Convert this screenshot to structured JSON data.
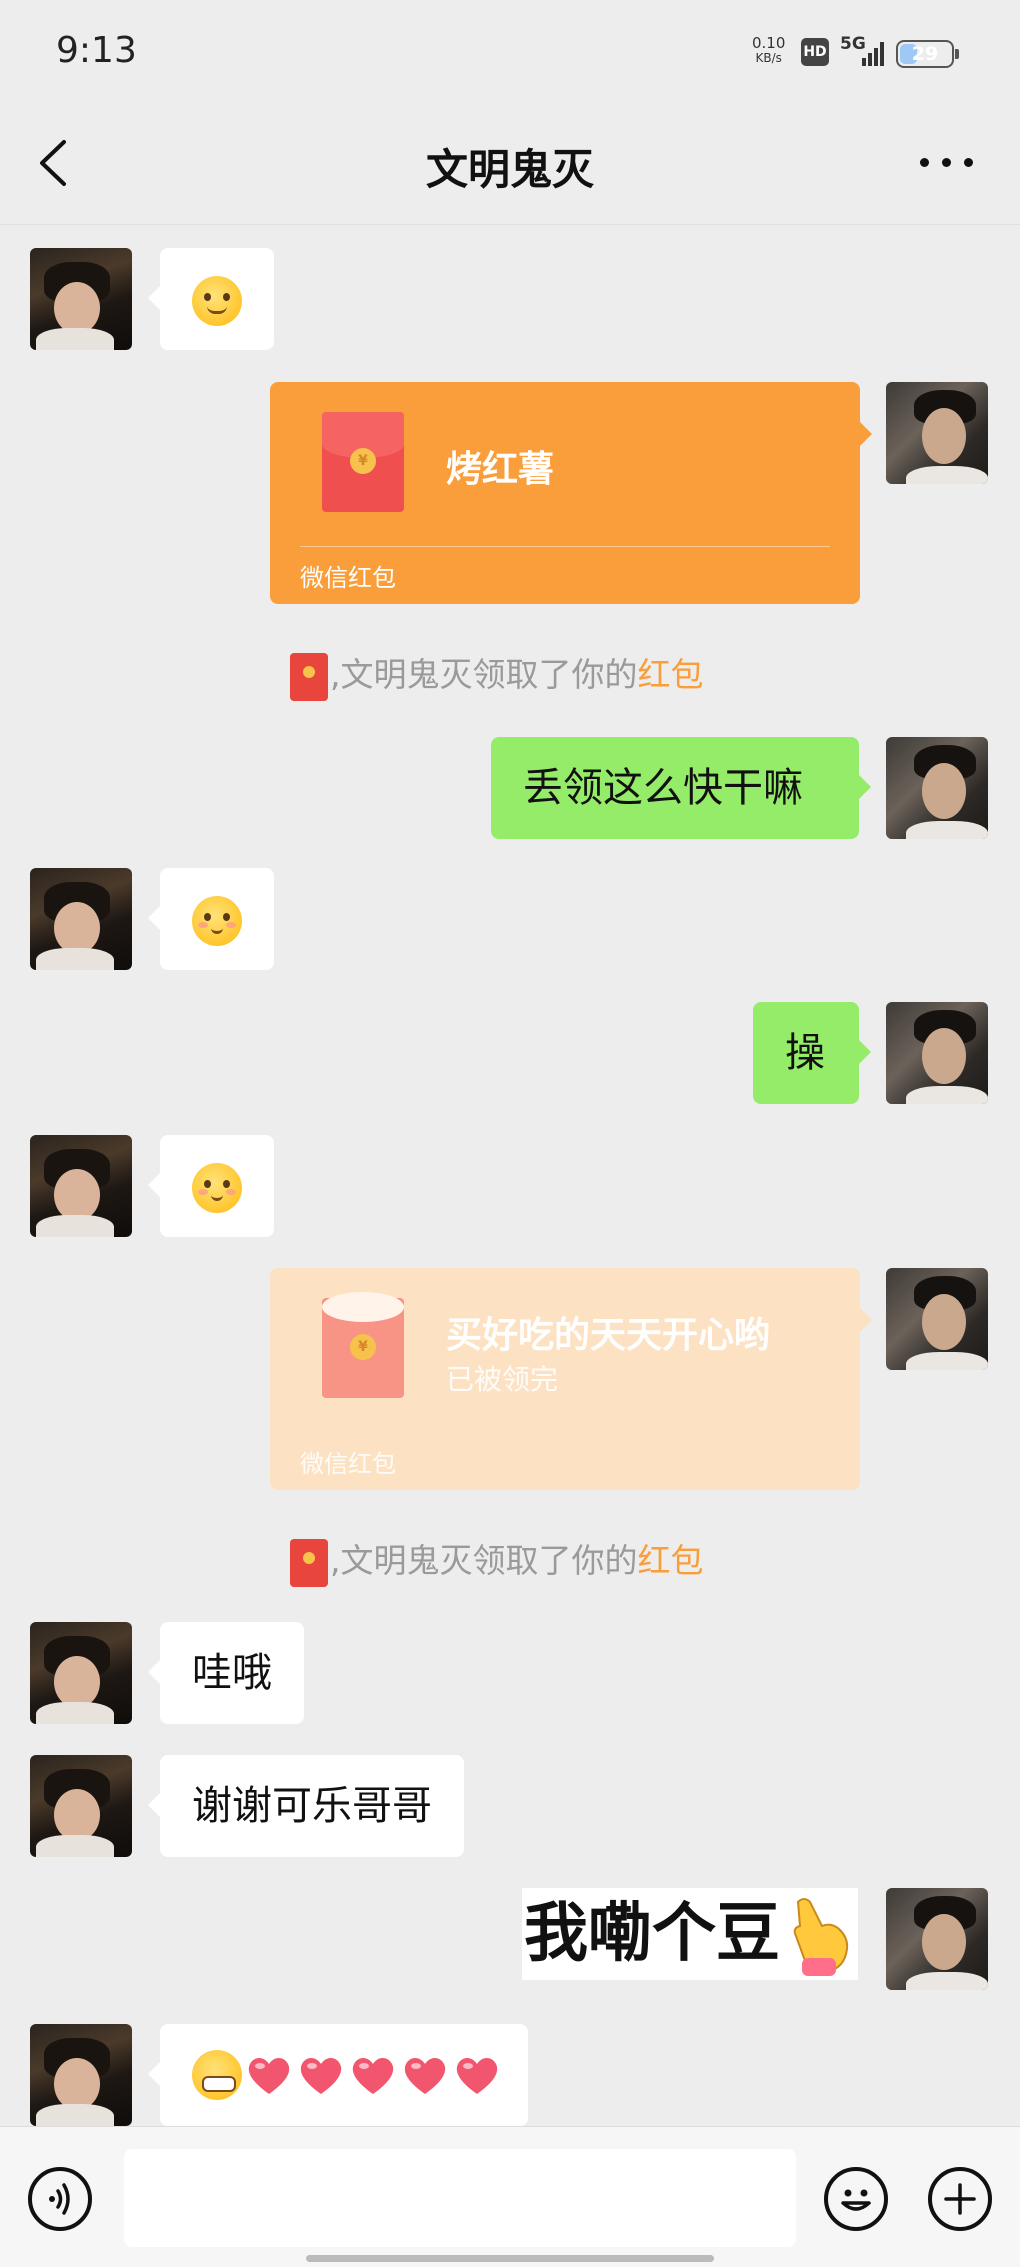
{
  "status_bar": {
    "time": "9:13",
    "net_speed": "0.10",
    "net_unit": "KB/s",
    "hd": "HD",
    "network": "5G",
    "battery": "29"
  },
  "header": {
    "title": "文明鬼灭",
    "back_icon": "chevron-left-icon",
    "more_icon": "more-dots-icon"
  },
  "messages": [
    {
      "from": "them",
      "type": "emoji",
      "emoji": "smile-emoji"
    },
    {
      "from": "me",
      "type": "red_packet",
      "title": "烤红薯",
      "label": "微信红包"
    },
    {
      "from": "system",
      "type": "notice",
      "text": "文明鬼灭领取了你的",
      "highlight": "红包"
    },
    {
      "from": "me",
      "type": "text",
      "text": "丢领这么快干嘛"
    },
    {
      "from": "them",
      "type": "emoji",
      "emoji": "blush-emoji"
    },
    {
      "from": "me",
      "type": "text",
      "text": "操"
    },
    {
      "from": "them",
      "type": "emoji",
      "emoji": "blush-emoji"
    },
    {
      "from": "me",
      "type": "red_packet",
      "title": "买好吃的天天开心哟",
      "status": "已被领完",
      "label": "微信红包"
    },
    {
      "from": "system",
      "type": "notice",
      "text": "文明鬼灭领取了你的",
      "highlight": "红包"
    },
    {
      "from": "them",
      "type": "text",
      "text": "哇哦"
    },
    {
      "from": "them",
      "type": "text",
      "text": "谢谢可乐哥哥"
    },
    {
      "from": "me",
      "type": "sticker",
      "text": "我嘞个豆"
    },
    {
      "from": "them",
      "type": "emoji_row",
      "emoji": [
        "grin-emoji",
        "heart-emoji",
        "heart-emoji",
        "heart-emoji",
        "heart-emoji",
        "heart-emoji"
      ]
    }
  ],
  "input_bar": {
    "voice_icon": "voice-icon",
    "emoji_icon": "emoji-icon",
    "plus_icon": "plus-icon"
  },
  "colors": {
    "background": "#ededed",
    "outgoing_bubble": "#95ec69",
    "red_packet": "#fa9d3b",
    "red_packet_opened": "#fde1c3",
    "highlight": "#fa9d3b"
  }
}
